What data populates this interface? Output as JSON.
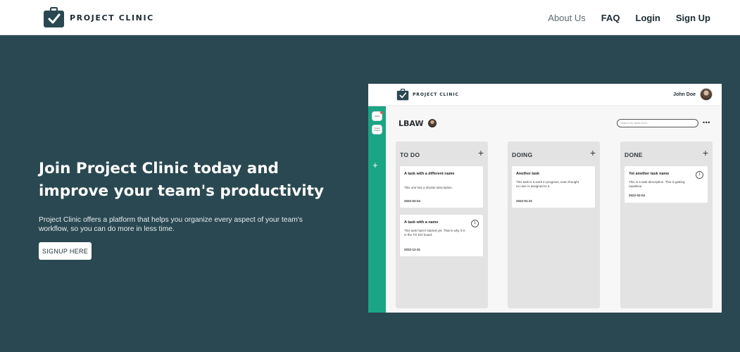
{
  "navbar": {
    "brand_name": "PROJECT CLINIC",
    "brand_icon": "clipboard-check-icon",
    "links": [
      {
        "label": "About Us"
      },
      {
        "label": "FAQ"
      },
      {
        "label": "Login"
      },
      {
        "label": "Sign Up"
      }
    ]
  },
  "hero": {
    "title": "Join Project Clinic today and improve your team's productivity",
    "description": "Project Clinic offers a platform that helps you organize every aspect of your team's workflow, so you can do more in less time.",
    "cta_label": "SIGNUP HERE"
  },
  "mockup": {
    "brand_name": "PROJECT CLINIC",
    "user_name": "John Doe",
    "sidebar": {
      "tiles": [
        "LBAW",
        "Create Project"
      ],
      "add_label": "+"
    },
    "project_title": "LBAW",
    "search_placeholder": "Search for tasks here...",
    "more_label": "•••",
    "columns": [
      {
        "title": "TO DO",
        "add_label": "+",
        "cards": [
          {
            "title": "A task with a different name",
            "description": "This one has a shorter description.",
            "date": "2022-02-04",
            "badge": ""
          },
          {
            "title": "A task with a name",
            "description": "This task hasn't started yet. That is why it is in the TO DO board.",
            "date": "2022-12-31",
            "badge": "1"
          }
        ]
      },
      {
        "title": "DOING",
        "add_label": "+",
        "cards": [
          {
            "title": "Another task",
            "description": "This task is a work in progress, even thought no user is assigned to it.",
            "date": "2022-01-31",
            "badge": ""
          }
        ]
      },
      {
        "title": "DONE",
        "add_label": "+",
        "cards": [
          {
            "title": "Yet another task name",
            "description": "This is a task description. This is getting repetitive.",
            "date": "2022-02-04",
            "badge": "1"
          }
        ]
      }
    ]
  },
  "colors": {
    "background": "#2a4851",
    "accent_green": "#1aa585",
    "white": "#ffffff"
  }
}
